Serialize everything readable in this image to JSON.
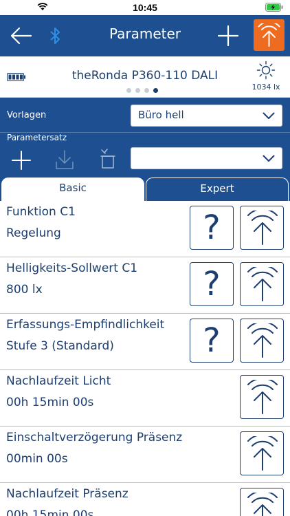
{
  "status_bar": {
    "time": "10:45"
  },
  "nav": {
    "title": "Parameter",
    "icons": {
      "back": "arrow-left-icon",
      "bluetooth": "bluetooth-icon",
      "add": "plus-icon",
      "transmit": "transmit-icon"
    },
    "accent_color": "#ef6b1f",
    "bar_color": "#1d4f91"
  },
  "device": {
    "name": "theRonda P360-110 DALI",
    "lux": "1034 lx",
    "page_count": 4,
    "active_page": 4
  },
  "settings": {
    "vorlagen_label": "Vorlagen",
    "vorlagen_value": "Büro hell",
    "parametersatz_label": "Parametersatz",
    "parametersatz_value": ""
  },
  "tabs": {
    "basic": "Basic",
    "expert": "Expert",
    "active": "Basic"
  },
  "params": [
    {
      "name": "Funktion C1",
      "value": "Regelung",
      "has_help": true
    },
    {
      "name": "Helligkeits-Sollwert C1",
      "value": "800 lx",
      "has_help": true
    },
    {
      "name": "Erfassungs-Empfindlichkeit",
      "value": "Stufe 3 (Standard)",
      "has_help": true
    },
    {
      "name": "Nachlaufzeit Licht",
      "value": "00h 15min 00s",
      "has_help": false
    },
    {
      "name": "Einschaltverzögerung Präsenz",
      "value": "00min 00s",
      "has_help": false
    },
    {
      "name": "Nachlaufzeit Präsenz",
      "value": "00h 15min 00s",
      "has_help": false
    }
  ],
  "help_glyph": "?"
}
